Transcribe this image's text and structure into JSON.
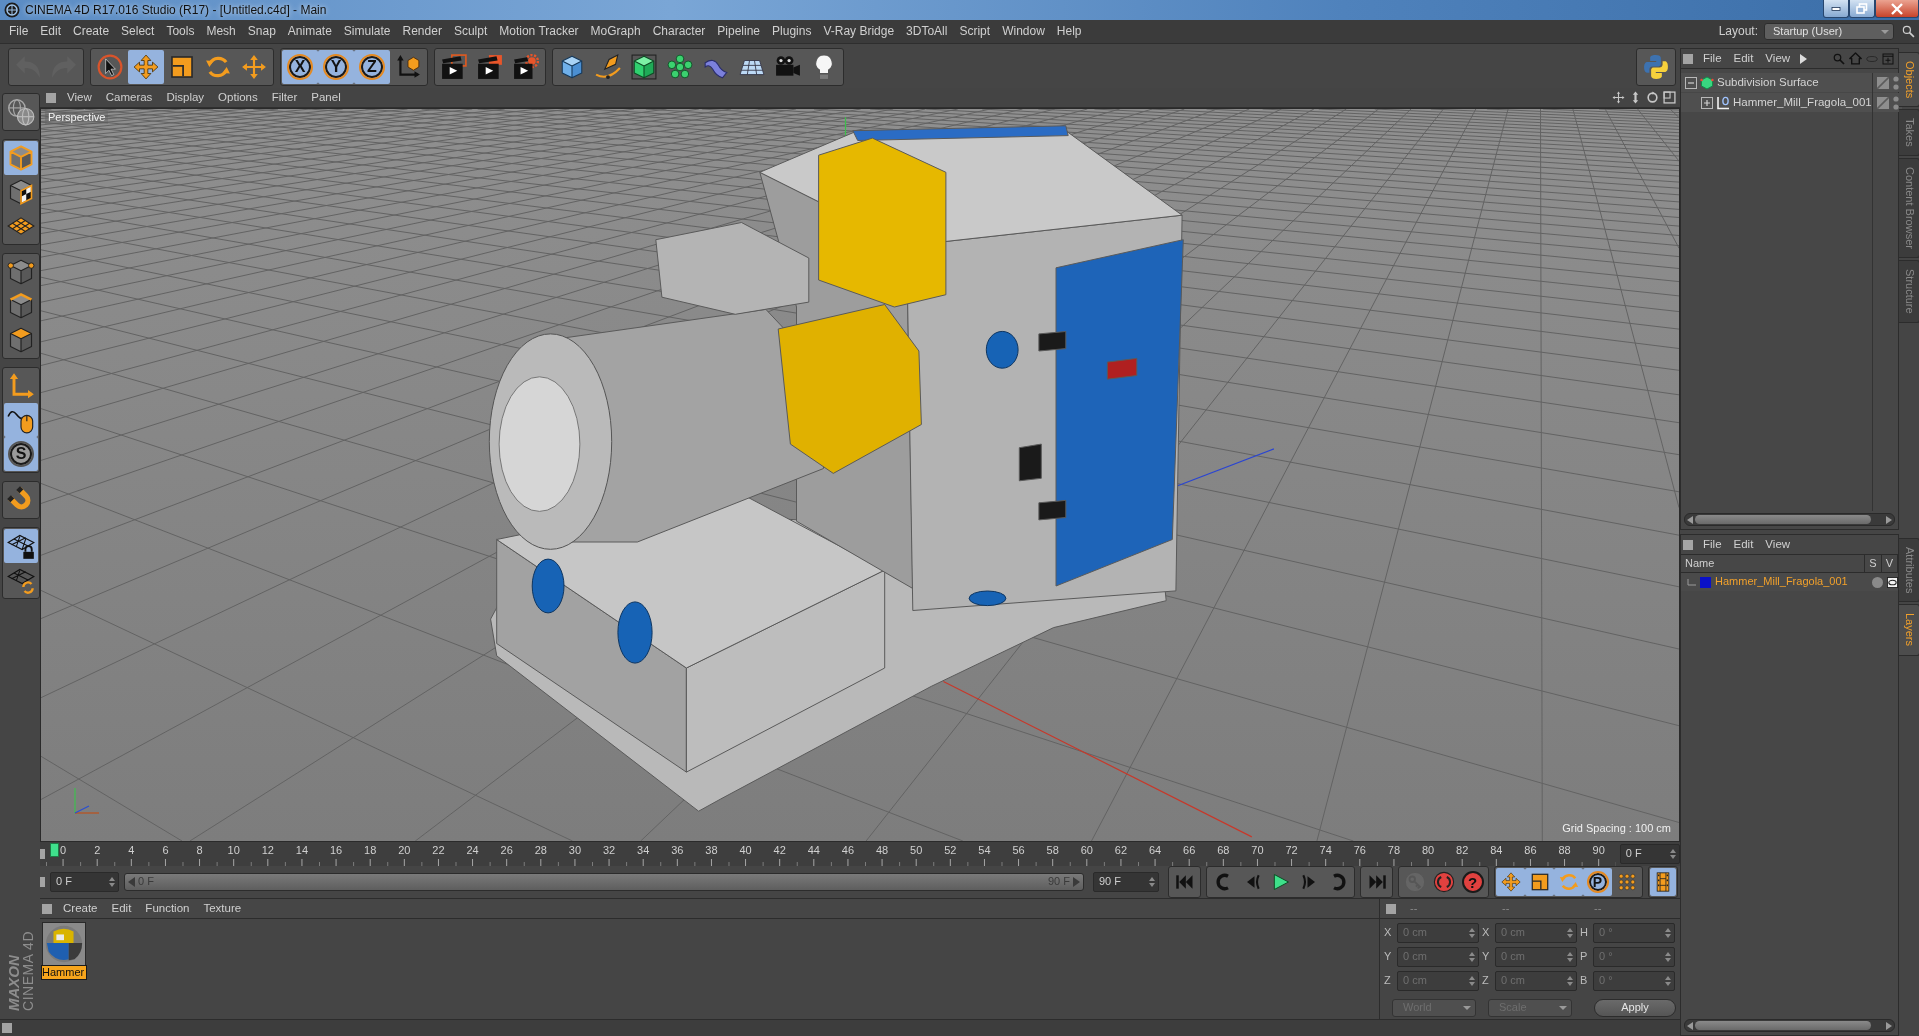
{
  "window": {
    "title": "CINEMA 4D R17.016 Studio (R17) - [Untitled.c4d] - Main"
  },
  "menu_bar": {
    "items": [
      "File",
      "Edit",
      "Create",
      "Select",
      "Tools",
      "Mesh",
      "Snap",
      "Animate",
      "Simulate",
      "Render",
      "Sculpt",
      "Motion Tracker",
      "MoGraph",
      "Character",
      "Pipeline",
      "Plugins",
      "V-Ray Bridge",
      "3DToAll",
      "Script",
      "Window",
      "Help"
    ],
    "layout_label": "Layout:",
    "layout_value": "Startup (User)"
  },
  "toolbar": {
    "groups": [
      {
        "disabled": true,
        "buttons": [
          {
            "selected": false
          },
          {
            "selected": false
          }
        ]
      },
      {
        "disabled": false,
        "buttons": [
          {
            "selected": false
          },
          {
            "selected": true
          },
          {
            "selected": false
          },
          {
            "selected": false
          },
          {
            "selected": false
          }
        ]
      },
      {
        "disabled": false,
        "buttons": [
          {
            "label": "X",
            "selected": true
          },
          {
            "label": "Y",
            "selected": true
          },
          {
            "label": "Z",
            "selected": true
          },
          {
            "selected": false
          }
        ]
      },
      {
        "disabled": false,
        "buttons": [
          {
            "selected": false
          },
          {
            "selected": false
          },
          {
            "selected": false
          }
        ]
      },
      {
        "disabled": false,
        "buttons": [
          {
            "selected": false
          },
          {
            "selected": false
          },
          {
            "selected": false
          },
          {
            "selected": false
          },
          {
            "selected": false
          },
          {
            "selected": false
          },
          {
            "selected": false
          },
          {
            "selected": false
          }
        ]
      }
    ]
  },
  "mode_toolbar": {
    "groups": [
      {
        "buttons": [
          {
            "selected": false
          }
        ]
      },
      {
        "buttons": [
          {
            "selected": true
          },
          {
            "selected": false
          },
          {
            "selected": false
          }
        ]
      },
      {
        "buttons": [
          {
            "selected": false
          },
          {
            "selected": false
          },
          {
            "selected": false
          }
        ]
      },
      {
        "buttons": [
          {
            "selected": false
          },
          {
            "selected": true
          },
          {
            "label": "S",
            "selected": true
          }
        ]
      },
      {
        "buttons": [
          {
            "selected": false
          }
        ]
      },
      {
        "buttons": [
          {
            "selected": true
          },
          {
            "selected": false
          }
        ]
      }
    ]
  },
  "viewport": {
    "menu": [
      "View",
      "Cameras",
      "Display",
      "Options",
      "Filter",
      "Panel"
    ],
    "camera_label": "Perspective",
    "grid_spacing": "Grid Spacing : 100 cm"
  },
  "timeline": {
    "frame_labels": [
      "0",
      "2",
      "4",
      "6",
      "8",
      "10",
      "12",
      "14",
      "16",
      "18",
      "20",
      "22",
      "24",
      "26",
      "28",
      "30",
      "32",
      "34",
      "36",
      "38",
      "40",
      "42",
      "44",
      "46",
      "48",
      "50",
      "52",
      "54",
      "56",
      "58",
      "60",
      "62",
      "64",
      "66",
      "68",
      "70",
      "72",
      "74",
      "76",
      "78",
      "80",
      "82",
      "84",
      "86",
      "88",
      "90"
    ],
    "playhead": {
      "level": 0
    },
    "current_frame": "0 F"
  },
  "frame_controls": {
    "start": "0 F",
    "range_start": "0 F",
    "range_end": "90 F",
    "end": "90 F",
    "record": [
      {
        "disabled": true
      },
      {
        "disabled": false
      },
      {
        "label": "?",
        "disabled": false
      }
    ],
    "keys": [
      {
        "selected": true
      },
      {
        "selected": true
      },
      {
        "selected": true
      },
      {
        "label": "P",
        "selected": true
      },
      {
        "selected": false
      }
    ],
    "timeline_button": {
      "selected": true
    }
  },
  "material_manager": {
    "menu": [
      "Create",
      "Edit",
      "Function",
      "Texture"
    ],
    "materials": [
      {
        "name": "Hammer",
        "selected": true
      }
    ]
  },
  "coordinates": {
    "headers": [
      "--",
      "--",
      "--"
    ],
    "disabled": true,
    "rows": [
      {
        "fields": [
          {
            "label": "X",
            "value": "0 cm"
          },
          {
            "label": "X",
            "value": "0 cm"
          },
          {
            "label": "H",
            "value": "0 °"
          }
        ]
      },
      {
        "fields": [
          {
            "label": "Y",
            "value": "0 cm"
          },
          {
            "label": "Y",
            "value": "0 cm"
          },
          {
            "label": "P",
            "value": "0 °"
          }
        ]
      },
      {
        "fields": [
          {
            "label": "Z",
            "value": "0 cm"
          },
          {
            "label": "Z",
            "value": "0 cm"
          },
          {
            "label": "B",
            "value": "0 °"
          }
        ]
      }
    ],
    "dropdowns": [
      "World",
      "Scale"
    ],
    "apply": "Apply"
  },
  "object_manager": {
    "menu": [
      "File",
      "Edit",
      "View"
    ],
    "tree": [
      {
        "name": "Subdivision Surface",
        "kind": "subdivision",
        "expanded": true,
        "children": [
          {
            "name": "Hammer_Mill_Fragola_001",
            "kind": "null",
            "expanded": false
          }
        ]
      }
    ]
  },
  "side_tabs": {
    "top": [
      {
        "label": "Objects",
        "selected": true
      },
      {
        "label": "Takes",
        "selected": false
      },
      {
        "label": "Content Browser",
        "selected": false
      },
      {
        "label": "Structure",
        "selected": false
      }
    ],
    "bottom": [
      {
        "label": "Attributes",
        "selected": false
      },
      {
        "label": "Layers",
        "selected": true
      }
    ]
  },
  "layer_manager": {
    "menu": [
      "File",
      "Edit",
      "View"
    ],
    "columns": [
      "Name",
      "S",
      "V"
    ],
    "layers": [
      {
        "name": "Hammer_Mill_Fragola_001",
        "color": "#0a10c8"
      }
    ]
  },
  "logo": {
    "brand": "MAXON",
    "product": "CINEMA 4D"
  }
}
